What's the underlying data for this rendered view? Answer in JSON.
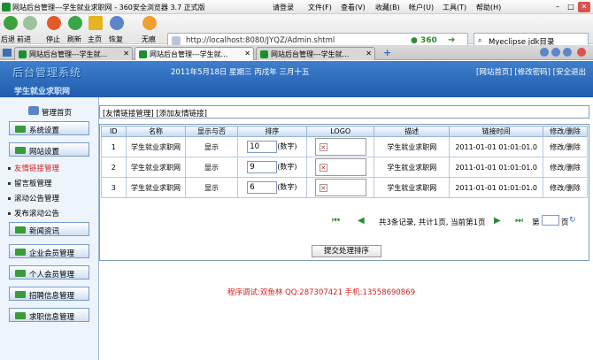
{
  "browser": {
    "window_title": "网站后台管理---学生就业求职网 - 360安全浏览器 3.7 正式版",
    "menu": [
      "请登录",
      "文件(F)",
      "查看(V)",
      "收藏(B)",
      "帐户(U)",
      "工具(T)",
      "帮助(H)"
    ],
    "nav_buttons": [
      "后退",
      "前进",
      "停止",
      "刷新",
      "主页",
      "恢复",
      "无痕"
    ],
    "address": "http://localhost:8080/JYQZ/Admin.shtml",
    "search_text": "Myeclipse jdk目录",
    "tabs": [
      {
        "label": "网站后台管理---学生就...",
        "active": false
      },
      {
        "label": "网站后台管理---学生就...",
        "active": true
      },
      {
        "label": "网站后台管理---学生就...",
        "active": false
      }
    ]
  },
  "header": {
    "logo": "后台管理系统",
    "site_name": "学生就业求职网",
    "date": "2011年5月18日 星期三 丙戌年 三月十五",
    "links": "[网站首页] [修改密码] [安全退出"
  },
  "sidebar": {
    "home": "管理首页",
    "sections": [
      {
        "label": "系统设置"
      },
      {
        "label": "网站设置",
        "items": [
          "友情链接管理",
          "留言板管理",
          "滚动公告管理",
          "发布滚动公告"
        ]
      },
      {
        "label": "新闻资讯"
      },
      {
        "label": "企业会员管理"
      },
      {
        "label": "个人会员管理"
      },
      {
        "label": "招聘信息管理"
      },
      {
        "label": "求职信息管理"
      }
    ]
  },
  "breadcrumb": "[友情链接管理] [添加友情链接]",
  "table": {
    "headers": [
      "ID",
      "名称",
      "显示与否",
      "排序",
      "LOGO",
      "描述",
      "链接时间",
      "修改/删除"
    ],
    "rows": [
      {
        "id": "1",
        "name": "学生就业求职网",
        "show": "显示",
        "order": "10",
        "order_hint": "(数字)",
        "desc": "学生就业求职网",
        "time": "2011-01-01 01:01:01.0",
        "action": "修改/删除"
      },
      {
        "id": "2",
        "name": "学生就业求职网",
        "show": "显示",
        "order": "9",
        "order_hint": "(数字)",
        "desc": "学生就业求职网",
        "time": "2011-01-01 01:01:01.0",
        "action": "修改/删除"
      },
      {
        "id": "3",
        "name": "学生就业求职网",
        "show": "显示",
        "order": "6",
        "order_hint": "(数字)",
        "desc": "学生就业求职网",
        "time": "2011-01-01 01:01:01.0",
        "action": "修改/删除"
      }
    ]
  },
  "pager": {
    "text": "共3条记录, 共计1页, 当前第1页",
    "page_label": "第",
    "page_suffix": "页"
  },
  "submit": "提交处理排序",
  "footer": "程序调试:双鱼林 QQ:287307421 手机:13558690869"
}
